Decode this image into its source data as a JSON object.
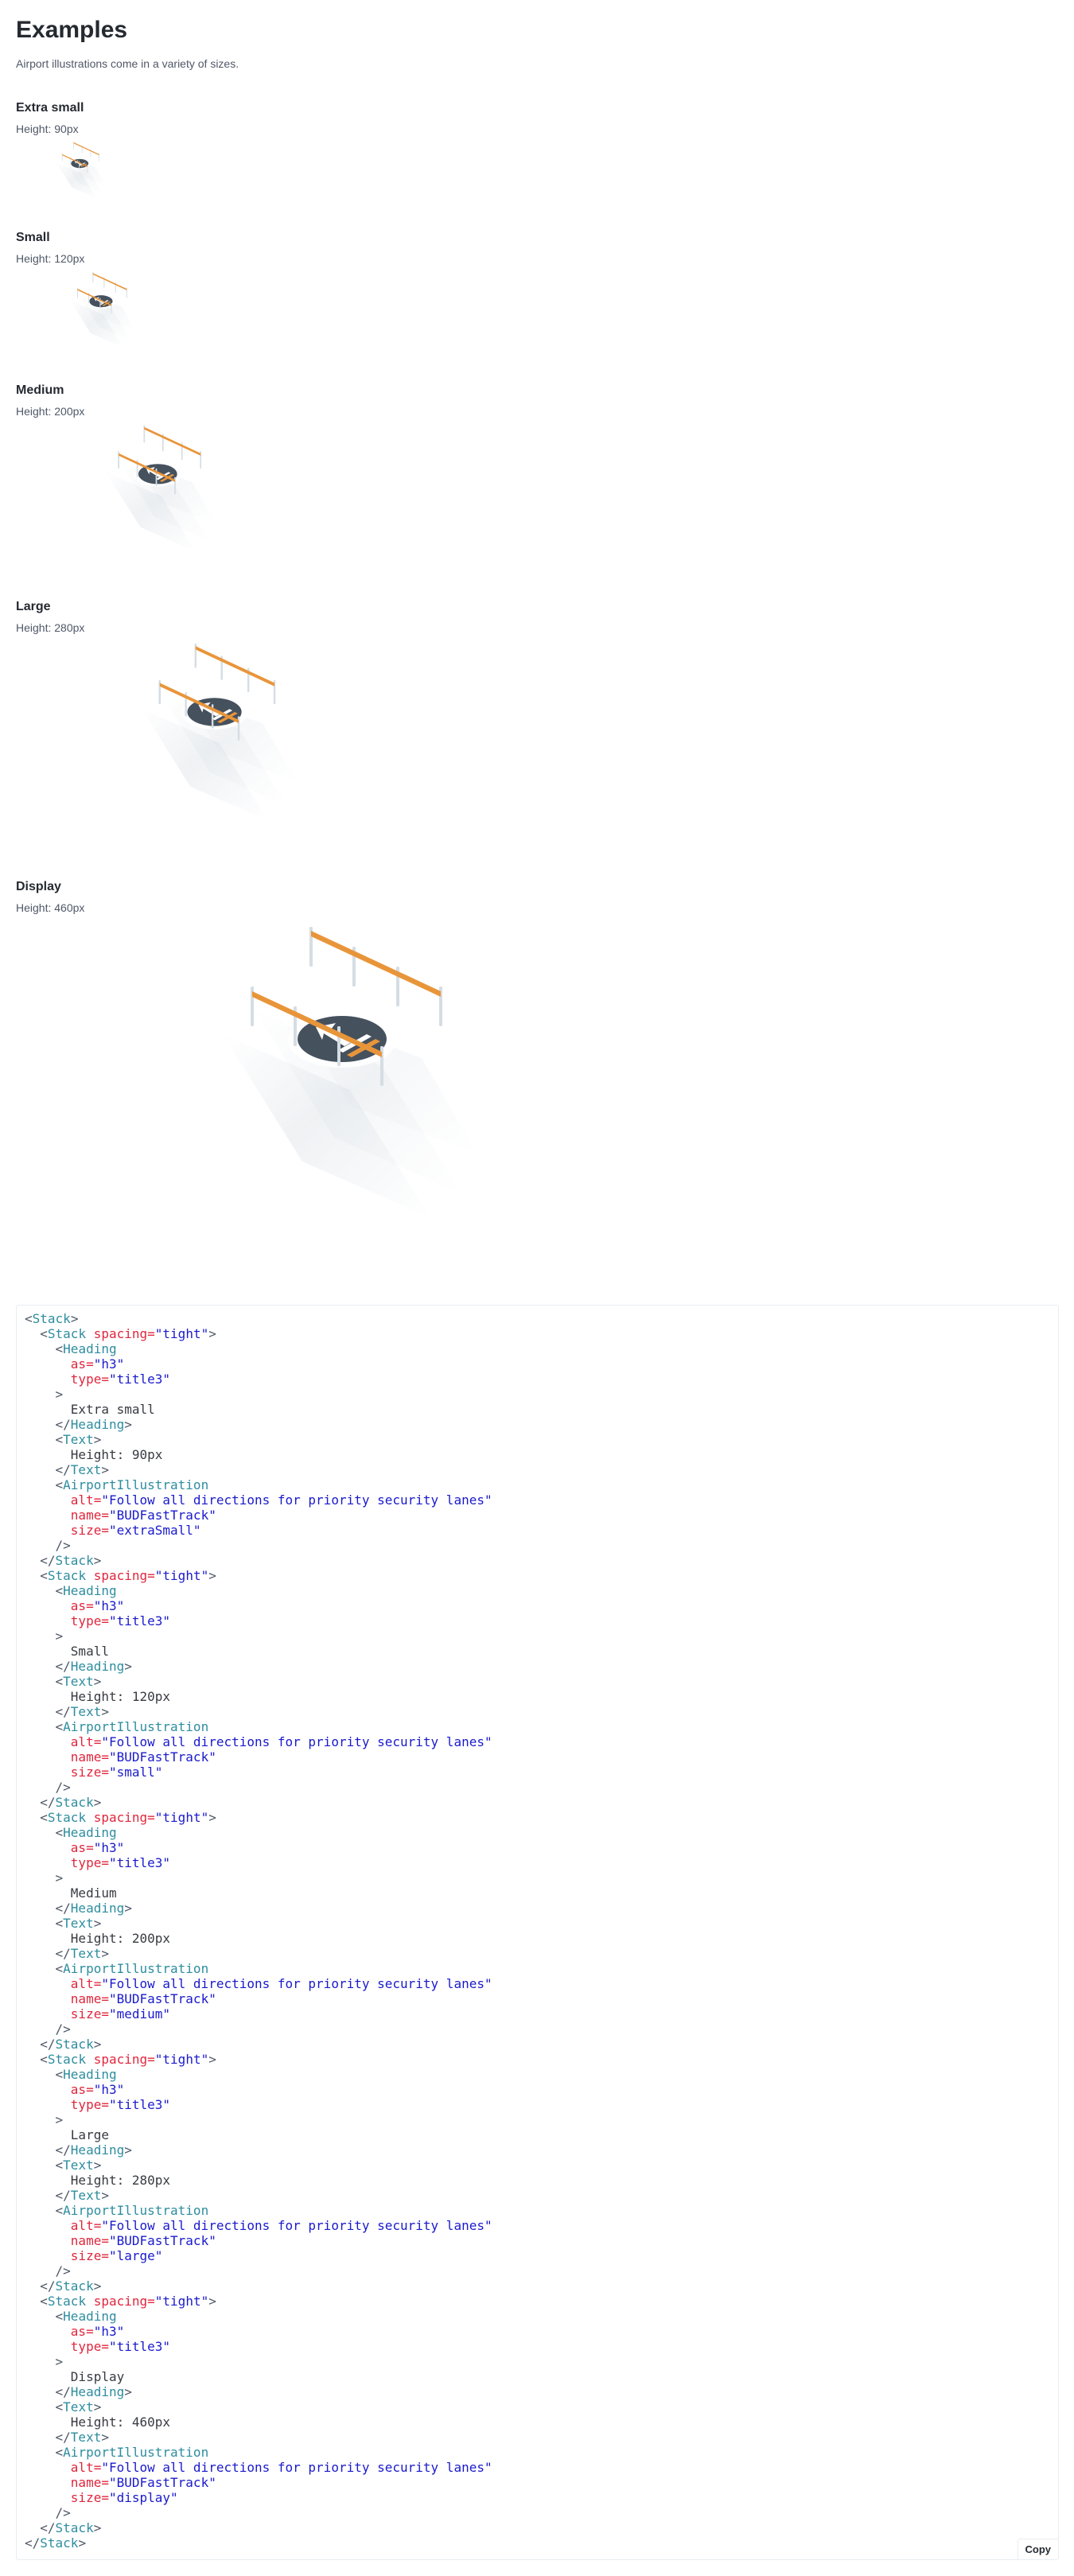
{
  "page": {
    "title": "Examples",
    "description": "Airport illustrations come in a variety of sizes."
  },
  "examples": [
    {
      "title": "Extra small",
      "meta": "Height: 90px",
      "size": "extraSmall"
    },
    {
      "title": "Small",
      "meta": "Height: 120px",
      "size": "small"
    },
    {
      "title": "Medium",
      "meta": "Height: 200px",
      "size": "medium"
    },
    {
      "title": "Large",
      "meta": "Height: 280px",
      "size": "large"
    },
    {
      "title": "Display",
      "meta": "Height: 460px",
      "size": "display"
    }
  ],
  "illustration": {
    "alt": "Follow all directions for priority security lanes",
    "name": "BUDFastTrack",
    "colors": {
      "rail": "#e8953a",
      "post": "#d5dde4",
      "sign": "#46515e",
      "signRim": "#ffffff",
      "arrow": "#ffffff",
      "shadow": "#dfe4e9"
    }
  },
  "code": {
    "lines": [
      [
        [
          "<",
          "punc"
        ],
        [
          "Stack",
          "tag"
        ],
        [
          ">",
          "punc"
        ]
      ],
      [
        [
          "  <",
          "punc"
        ],
        [
          "Stack",
          "tag"
        ],
        [
          " spacing=",
          "attr"
        ],
        [
          "\"tight\"",
          "str"
        ],
        [
          ">",
          "punc"
        ]
      ],
      [
        [
          "    <",
          "punc"
        ],
        [
          "Heading",
          "tag"
        ]
      ],
      [
        [
          "      as=",
          "attr"
        ],
        [
          "\"h3\"",
          "str"
        ]
      ],
      [
        [
          "      type=",
          "attr"
        ],
        [
          "\"title3\"",
          "str"
        ]
      ],
      [
        [
          "    >",
          "punc"
        ]
      ],
      [
        [
          "      Extra small",
          "text"
        ]
      ],
      [
        [
          "    </",
          "punc"
        ],
        [
          "Heading",
          "tag"
        ],
        [
          ">",
          "punc"
        ]
      ],
      [
        [
          "    <",
          "punc"
        ],
        [
          "Text",
          "tag"
        ],
        [
          ">",
          "punc"
        ]
      ],
      [
        [
          "      Height: 90px",
          "text"
        ]
      ],
      [
        [
          "    </",
          "punc"
        ],
        [
          "Text",
          "tag"
        ],
        [
          ">",
          "punc"
        ]
      ],
      [
        [
          "    <",
          "punc"
        ],
        [
          "AirportIllustration",
          "tag"
        ]
      ],
      [
        [
          "      alt=",
          "attr"
        ],
        [
          "\"Follow all directions for priority security lanes\"",
          "str"
        ]
      ],
      [
        [
          "      name=",
          "attr"
        ],
        [
          "\"BUDFastTrack\"",
          "str"
        ]
      ],
      [
        [
          "      size=",
          "attr"
        ],
        [
          "\"extraSmall\"",
          "str"
        ]
      ],
      [
        [
          "    />",
          "punc"
        ]
      ],
      [
        [
          "  </",
          "punc"
        ],
        [
          "Stack",
          "tag"
        ],
        [
          ">",
          "punc"
        ]
      ],
      [
        [
          "  <",
          "punc"
        ],
        [
          "Stack",
          "tag"
        ],
        [
          " spacing=",
          "attr"
        ],
        [
          "\"tight\"",
          "str"
        ],
        [
          ">",
          "punc"
        ]
      ],
      [
        [
          "    <",
          "punc"
        ],
        [
          "Heading",
          "tag"
        ]
      ],
      [
        [
          "      as=",
          "attr"
        ],
        [
          "\"h3\"",
          "str"
        ]
      ],
      [
        [
          "      type=",
          "attr"
        ],
        [
          "\"title3\"",
          "str"
        ]
      ],
      [
        [
          "    >",
          "punc"
        ]
      ],
      [
        [
          "      Small",
          "text"
        ]
      ],
      [
        [
          "    </",
          "punc"
        ],
        [
          "Heading",
          "tag"
        ],
        [
          ">",
          "punc"
        ]
      ],
      [
        [
          "    <",
          "punc"
        ],
        [
          "Text",
          "tag"
        ],
        [
          ">",
          "punc"
        ]
      ],
      [
        [
          "      Height: 120px",
          "text"
        ]
      ],
      [
        [
          "    </",
          "punc"
        ],
        [
          "Text",
          "tag"
        ],
        [
          ">",
          "punc"
        ]
      ],
      [
        [
          "    <",
          "punc"
        ],
        [
          "AirportIllustration",
          "tag"
        ]
      ],
      [
        [
          "      alt=",
          "attr"
        ],
        [
          "\"Follow all directions for priority security lanes\"",
          "str"
        ]
      ],
      [
        [
          "      name=",
          "attr"
        ],
        [
          "\"BUDFastTrack\"",
          "str"
        ]
      ],
      [
        [
          "      size=",
          "attr"
        ],
        [
          "\"small\"",
          "str"
        ]
      ],
      [
        [
          "    />",
          "punc"
        ]
      ],
      [
        [
          "  </",
          "punc"
        ],
        [
          "Stack",
          "tag"
        ],
        [
          ">",
          "punc"
        ]
      ],
      [
        [
          "  <",
          "punc"
        ],
        [
          "Stack",
          "tag"
        ],
        [
          " spacing=",
          "attr"
        ],
        [
          "\"tight\"",
          "str"
        ],
        [
          ">",
          "punc"
        ]
      ],
      [
        [
          "    <",
          "punc"
        ],
        [
          "Heading",
          "tag"
        ]
      ],
      [
        [
          "      as=",
          "attr"
        ],
        [
          "\"h3\"",
          "str"
        ]
      ],
      [
        [
          "      type=",
          "attr"
        ],
        [
          "\"title3\"",
          "str"
        ]
      ],
      [
        [
          "    >",
          "punc"
        ]
      ],
      [
        [
          "      Medium",
          "text"
        ]
      ],
      [
        [
          "    </",
          "punc"
        ],
        [
          "Heading",
          "tag"
        ],
        [
          ">",
          "punc"
        ]
      ],
      [
        [
          "    <",
          "punc"
        ],
        [
          "Text",
          "tag"
        ],
        [
          ">",
          "punc"
        ]
      ],
      [
        [
          "      Height: 200px",
          "text"
        ]
      ],
      [
        [
          "    </",
          "punc"
        ],
        [
          "Text",
          "tag"
        ],
        [
          ">",
          "punc"
        ]
      ],
      [
        [
          "    <",
          "punc"
        ],
        [
          "AirportIllustration",
          "tag"
        ]
      ],
      [
        [
          "      alt=",
          "attr"
        ],
        [
          "\"Follow all directions for priority security lanes\"",
          "str"
        ]
      ],
      [
        [
          "      name=",
          "attr"
        ],
        [
          "\"BUDFastTrack\"",
          "str"
        ]
      ],
      [
        [
          "      size=",
          "attr"
        ],
        [
          "\"medium\"",
          "str"
        ]
      ],
      [
        [
          "    />",
          "punc"
        ]
      ],
      [
        [
          "  </",
          "punc"
        ],
        [
          "Stack",
          "tag"
        ],
        [
          ">",
          "punc"
        ]
      ],
      [
        [
          "  <",
          "punc"
        ],
        [
          "Stack",
          "tag"
        ],
        [
          " spacing=",
          "attr"
        ],
        [
          "\"tight\"",
          "str"
        ],
        [
          ">",
          "punc"
        ]
      ],
      [
        [
          "    <",
          "punc"
        ],
        [
          "Heading",
          "tag"
        ]
      ],
      [
        [
          "      as=",
          "attr"
        ],
        [
          "\"h3\"",
          "str"
        ]
      ],
      [
        [
          "      type=",
          "attr"
        ],
        [
          "\"title3\"",
          "str"
        ]
      ],
      [
        [
          "    >",
          "punc"
        ]
      ],
      [
        [
          "      Large",
          "text"
        ]
      ],
      [
        [
          "    </",
          "punc"
        ],
        [
          "Heading",
          "tag"
        ],
        [
          ">",
          "punc"
        ]
      ],
      [
        [
          "    <",
          "punc"
        ],
        [
          "Text",
          "tag"
        ],
        [
          ">",
          "punc"
        ]
      ],
      [
        [
          "      Height: 280px",
          "text"
        ]
      ],
      [
        [
          "    </",
          "punc"
        ],
        [
          "Text",
          "tag"
        ],
        [
          ">",
          "punc"
        ]
      ],
      [
        [
          "    <",
          "punc"
        ],
        [
          "AirportIllustration",
          "tag"
        ]
      ],
      [
        [
          "      alt=",
          "attr"
        ],
        [
          "\"Follow all directions for priority security lanes\"",
          "str"
        ]
      ],
      [
        [
          "      name=",
          "attr"
        ],
        [
          "\"BUDFastTrack\"",
          "str"
        ]
      ],
      [
        [
          "      size=",
          "attr"
        ],
        [
          "\"large\"",
          "str"
        ]
      ],
      [
        [
          "    />",
          "punc"
        ]
      ],
      [
        [
          "  </",
          "punc"
        ],
        [
          "Stack",
          "tag"
        ],
        [
          ">",
          "punc"
        ]
      ],
      [
        [
          "  <",
          "punc"
        ],
        [
          "Stack",
          "tag"
        ],
        [
          " spacing=",
          "attr"
        ],
        [
          "\"tight\"",
          "str"
        ],
        [
          ">",
          "punc"
        ]
      ],
      [
        [
          "    <",
          "punc"
        ],
        [
          "Heading",
          "tag"
        ]
      ],
      [
        [
          "      as=",
          "attr"
        ],
        [
          "\"h3\"",
          "str"
        ]
      ],
      [
        [
          "      type=",
          "attr"
        ],
        [
          "\"title3\"",
          "str"
        ]
      ],
      [
        [
          "    >",
          "punc"
        ]
      ],
      [
        [
          "      Display",
          "text"
        ]
      ],
      [
        [
          "    </",
          "punc"
        ],
        [
          "Heading",
          "tag"
        ],
        [
          ">",
          "punc"
        ]
      ],
      [
        [
          "    <",
          "punc"
        ],
        [
          "Text",
          "tag"
        ],
        [
          ">",
          "punc"
        ]
      ],
      [
        [
          "      Height: 460px",
          "text"
        ]
      ],
      [
        [
          "    </",
          "punc"
        ],
        [
          "Text",
          "tag"
        ],
        [
          ">",
          "punc"
        ]
      ],
      [
        [
          "    <",
          "punc"
        ],
        [
          "AirportIllustration",
          "tag"
        ]
      ],
      [
        [
          "      alt=",
          "attr"
        ],
        [
          "\"Follow all directions for priority security lanes\"",
          "str"
        ]
      ],
      [
        [
          "      name=",
          "attr"
        ],
        [
          "\"BUDFastTrack\"",
          "str"
        ]
      ],
      [
        [
          "      size=",
          "attr"
        ],
        [
          "\"display\"",
          "str"
        ]
      ],
      [
        [
          "    />",
          "punc"
        ]
      ],
      [
        [
          "  </",
          "punc"
        ],
        [
          "Stack",
          "tag"
        ],
        [
          ">",
          "punc"
        ]
      ],
      [
        [
          "</",
          "punc"
        ],
        [
          "Stack",
          "tag"
        ],
        [
          ">",
          "punc"
        ]
      ]
    ],
    "copy_label": "Copy"
  }
}
